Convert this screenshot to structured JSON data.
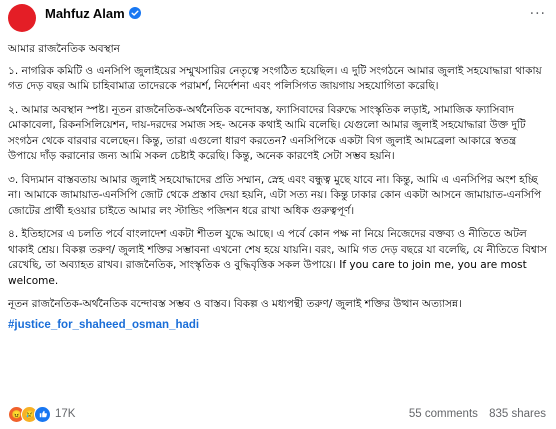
{
  "post": {
    "author": "Mahfuz Alam",
    "more_label": "···",
    "paragraphs": [
      "আমার রাজনৈতিক অবস্থান",
      "১. নাগরিক কমিটি ও এনসিপি জুলাইয়ের সম্মুখসারির নেতৃত্বে সংগঠিত হয়েছিল। এ দুটি সংগঠনে আমার জুলাই সহযোদ্ধারা থাকায় গত দেড় বছর আমি চাহিবামাত্র তাদেরকে পরামর্শ, নির্দেশনা এবং পলিসিগত জায়গায় সহযোগিতা করেছি।",
      "২. আমার অবস্থান স্পষ্ট। নূতন রাজনৈতিক-অর্থনৈতিক বন্দোবস্ত, ফ্যাসিবাদের বিরুদ্ধে সাংস্কৃতিক লড়াই, সামাজিক ফ্যাসিবাদ মোকাবেলা, রিকনসিলিয়েশন, দায়-দরদের সমাজ সহ- অনেক কথাই আমি বলেছি। যেগুলো আমার জুলাই সহযোদ্ধারা উক্ত দুটি সংগঠন থেকে বারবার বলেছেন। কিন্তু, তারা এগুলো ধারণ করতেন? এনসিপিকে একটা বিগ জুলাই আমব্রেলা আকারে স্বতন্ত্র উপায়ে দাঁড় করানোর জন্য আমি সকল চেষ্টাই করেছি। কিন্তু, অনেক কারণেই সেটা সম্ভব হয়নি।",
      "৩. বিদ্যমান বাস্তবতায় আমার জুলাই সহযোদ্ধাদের প্রতি সম্মান, স্নেহ এবং বন্ধুত্ব মুছে যাবে না। কিন্তু, আমি এ এনসিপির অংশ হচ্ছি না। আমাকে জামায়াত-এনসিপি জোট থেকে প্রস্তাব দেয়া হয়নি, এটা সত্য নয়। কিন্তু ঢাকার কোন একটা আসনে জামায়াত-এনসিপি জোটের প্রার্থী হওয়ার চাইতে আমার লং স্টান্ডিং পজিশন ধরে রাখা অধিক গুরুত্বপূর্ণ।",
      "৪. ইতিহাসের এ চলতি পর্বে বাংলাদেশ একটা শীতল যুদ্ধে আছে। এ পর্বে কোন পক্ষ না নিয়ে নিজেদের বক্তব্য ও নীতিতে অটল থাকাই শ্রেয়। বিকল্প তরুণ/ জুলাই শক্তির সম্ভাবনা এখনো শেষ হয়ে যায়নি। বরং, আমি গত দেড় বছরে যা বলেছি, যে নীতিতে বিশ্বাস রেখেছি, তা অব্যাহত রাখব। রাজনৈতিক, সাংস্কৃতিক ও বুদ্ধিবৃত্তিক সকল উপায়ে। If you care to join me, you are most welcome.",
      "নূতন রাজনৈতিক-অর্থনৈতিক বন্দোবস্ত সম্ভব ও বাস্তব। বিকল্প ও মধ্যপন্থী তরুণ/ জুলাই শক্তির উত্থান অত্যাসন্ন।"
    ],
    "hashtag": "#justice_for_shaheed_osman_hadi"
  },
  "footer": {
    "reaction_count": "17K",
    "comments": "55 comments",
    "shares": "835 shares"
  },
  "colors": {
    "avatar": "#e41e26",
    "link": "#1a6ed8",
    "verified": "#1877f2"
  }
}
